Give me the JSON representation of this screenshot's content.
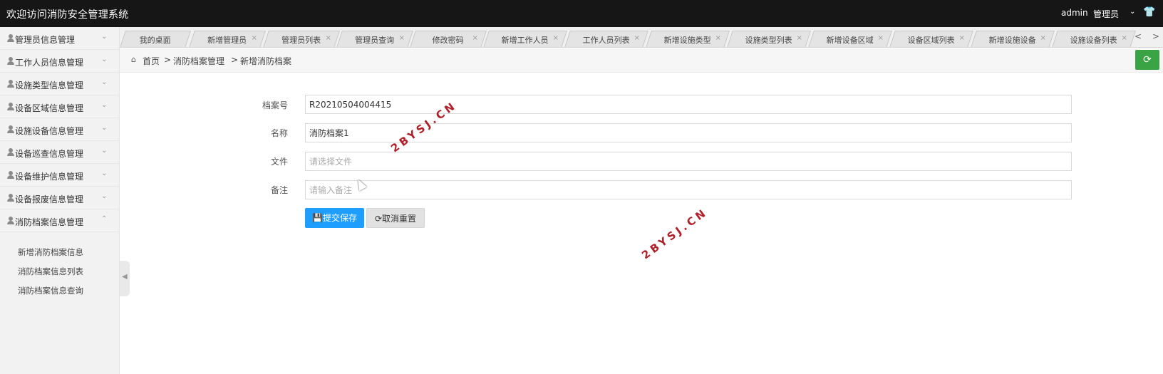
{
  "app": {
    "title": "欢迎访问消防安全管理系统",
    "user": "admin",
    "role": "管理员"
  },
  "sidebar": {
    "items": [
      {
        "label": "管理员信息管理",
        "expanded": false
      },
      {
        "label": "工作人员信息管理",
        "expanded": false
      },
      {
        "label": "设施类型信息管理",
        "expanded": false
      },
      {
        "label": "设备区域信息管理",
        "expanded": false
      },
      {
        "label": "设施设备信息管理",
        "expanded": false
      },
      {
        "label": "设备巡查信息管理",
        "expanded": false
      },
      {
        "label": "设备维护信息管理",
        "expanded": false
      },
      {
        "label": "设备报废信息管理",
        "expanded": false
      },
      {
        "label": "消防档案信息管理",
        "expanded": true
      }
    ],
    "subitems": [
      "新增消防档案信息",
      "消防档案信息列表",
      "消防档案信息查询"
    ]
  },
  "tabs": [
    "我的桌面",
    "新增管理员",
    "管理员列表",
    "管理员查询",
    "修改密码",
    "新增工作人员",
    "工作人员列表",
    "新增设施类型",
    "设施类型列表",
    "新增设备区域",
    "设备区域列表",
    "新增设施设备",
    "设施设备列表"
  ],
  "breadcrumb": [
    "首页",
    "消防档案管理",
    "新增消防档案"
  ],
  "form": {
    "fields": [
      {
        "label": "档案号",
        "value": "R20210504004415",
        "placeholder": ""
      },
      {
        "label": "名称",
        "value": "消防档案1",
        "placeholder": ""
      },
      {
        "label": "文件",
        "value": "",
        "placeholder": "请选择文件"
      },
      {
        "label": "备注",
        "value": "",
        "placeholder": "请输入备注"
      }
    ],
    "submit_label": "提交保存",
    "reset_label": "取消重置"
  },
  "watermark": "2BYSJ.CN",
  "colors": {
    "topbar": "#161616",
    "primary": "#1e9fff",
    "refresh": "#3aa343",
    "watermark": "#b0202a"
  }
}
